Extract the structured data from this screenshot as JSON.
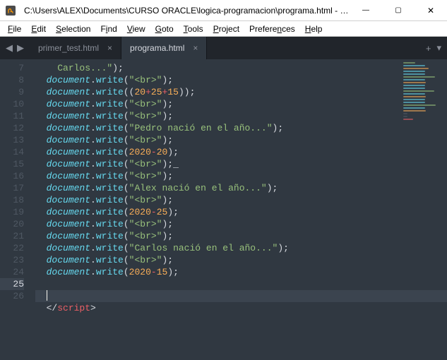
{
  "window": {
    "title": "C:\\Users\\ALEX\\Documents\\CURSO ORACLE\\logica-programacion\\programa.html - Su…"
  },
  "menu": {
    "file": {
      "ul": "F",
      "rest": "ile"
    },
    "edit": {
      "ul": "E",
      "rest": "dit"
    },
    "selection": {
      "ul": "S",
      "rest": "election"
    },
    "find": {
      "pre": "F",
      "ul": "i",
      "rest": "nd"
    },
    "view": {
      "ul": "V",
      "rest": "iew"
    },
    "goto": {
      "ul": "G",
      "rest": "oto"
    },
    "tools": {
      "ul": "T",
      "rest": "ools"
    },
    "project": {
      "ul": "P",
      "rest": "roject"
    },
    "preferences": {
      "pre": "Prefere",
      "ul": "n",
      "rest": "ces"
    },
    "help": {
      "ul": "H",
      "rest": "elp"
    }
  },
  "tabs": {
    "t0": {
      "label": "primer_test.html"
    },
    "t1": {
      "label": "programa.html"
    }
  },
  "code": {
    "indent2": "    ",
    "indent1": "  ",
    "doc": "document",
    "dot": ".",
    "write": "write",
    "lpar": "(",
    "rpar": ")",
    "semi": ";",
    "plus": "+",
    "minus": "-",
    "qCarlos": "Carlos...\"",
    "br": "\"<br>\"",
    "num20": "20",
    "num25": "25",
    "num15": "15",
    "num2020": "2020",
    "qPedro": "\"Pedro nació en el año...\"",
    "qAlex": "\"Alex nació en el año...\"",
    "qCarlosFull": "\"Carlos nació en el año...\"",
    "scriptCloseOpen": "</",
    "scriptTag": "script",
    "scriptCloseEnd": ">",
    "ln7": "7",
    "ln8": "8",
    "ln9": "9",
    "ln10": "10",
    "ln11": "11",
    "ln12": "12",
    "ln13": "13",
    "ln14": "14",
    "ln15": "15",
    "ln16": "16",
    "ln17": "17",
    "ln18": "18",
    "ln19": "19",
    "ln20": "20",
    "ln21": "21",
    "ln22": "22",
    "ln23": "23",
    "ln24": "24",
    "ln25": "25",
    "ln26": "26",
    "underscore": "_"
  }
}
